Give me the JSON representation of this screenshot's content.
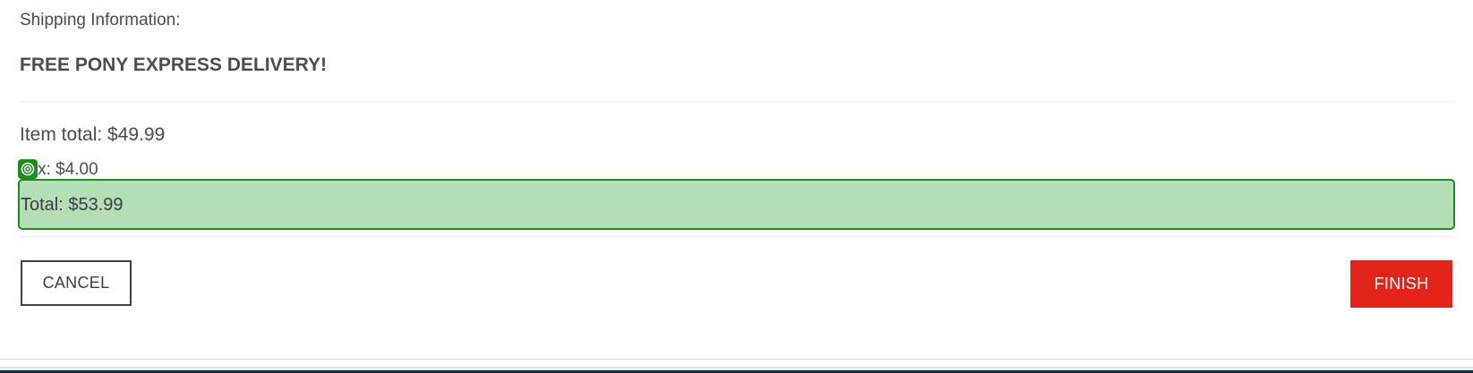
{
  "shipping": {
    "label": "Shipping Information:",
    "value": "FREE PONY EXPRESS DELIVERY!"
  },
  "summary": {
    "item_total": "Item total: $49.99",
    "tax": "Tax: $4.00",
    "total": "Total: $53.99"
  },
  "buttons": {
    "cancel": "CANCEL",
    "finish": "FINISH"
  },
  "overlay": {
    "highlight_color": "#b3deb6",
    "highlight_border": "#1f8a1f",
    "badge_icon": "target-icon"
  },
  "colors": {
    "finish_button": "#e2231a",
    "text": "#484c55"
  }
}
